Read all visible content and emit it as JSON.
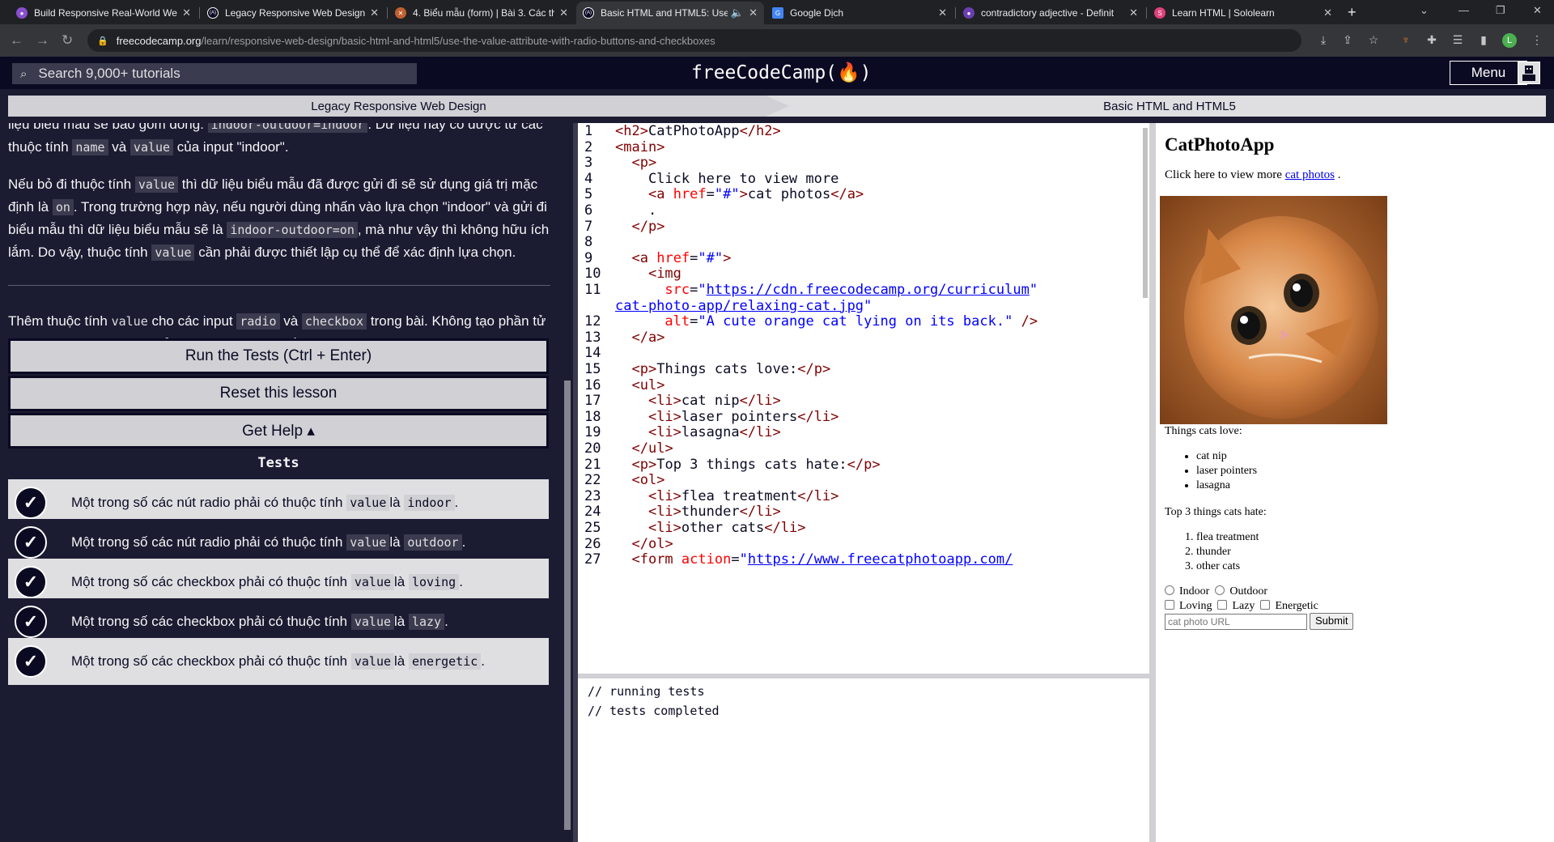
{
  "browser": {
    "tabs": [
      {
        "title": "Build Responsive Real-World We",
        "color": "#8a4fcf",
        "glyph": "●"
      },
      {
        "title": "Legacy Responsive Web Design",
        "color": "#0a0a23",
        "glyph": "(A)"
      },
      {
        "title": "4. Biểu mẫu (form) | Bài 3. Các th",
        "color": "#c06030",
        "glyph": "✕"
      },
      {
        "title": "Basic HTML and HTML5: Use",
        "color": "#0a0a23",
        "glyph": "(A)"
      },
      {
        "title": "Google Dịch",
        "color": "#4285f4",
        "glyph": "G"
      },
      {
        "title": "contradictory adjective - Definit",
        "color": "#6b3fb0",
        "glyph": "●"
      },
      {
        "title": "Learn HTML | Sololearn",
        "color": "#e0407a",
        "glyph": "S"
      }
    ],
    "url_host": "freecodecamp.org",
    "url_path": "/learn/responsive-web-design/basic-html-and-html5/use-the-value-attribute-with-radio-buttons-and-checkboxes",
    "profile_initial": "L"
  },
  "navbar": {
    "search_placeholder": "Search 9,000+ tutorials",
    "brand": "freeCodeCamp(🔥)",
    "menu_label": "Menu"
  },
  "breadcrumb": {
    "course": "Legacy Responsive Web Design",
    "section": "Basic HTML and HTML5"
  },
  "instructions": {
    "p1_pre": "liệu biểu mẫu sẽ bao gồm dòng: ",
    "p1_code1": "indoor-outdoor=indoor",
    "p1_mid": ". Dữ liệu này có được từ các thuộc tính ",
    "p1_code2": "name",
    "p1_and": " và ",
    "p1_code3": "value",
    "p1_post": " của input \"indoor\".",
    "p2_a": "Nếu bỏ đi thuộc tính ",
    "p2_code1": "value",
    "p2_b": " thì dữ liệu biểu mẫu đã được gửi đi sẽ sử dụng giá trị mặc định là ",
    "p2_code2": "on",
    "p2_c": ". Trong trường hợp này, nếu người dùng nhấn vào lựa chọn \"indoor\" và gửi đi biểu mẫu thì dữ liệu biểu mẫu sẽ là ",
    "p2_code3": "indoor-outdoor=on",
    "p2_d": ", mà như vậy thì không hữu ích lắm. Do vậy, thuộc tính ",
    "p2_code4": "value",
    "p2_e": " cần phải được thiết lập cụ thể để xác định lựa chọn.",
    "p3_a": "Thêm thuộc tính ",
    "p3_code1": "value",
    "p3_b": " cho các input ",
    "p3_code2": "radio",
    "p3_c": " và ",
    "p3_code3": "checkbox",
    "p3_d": " trong bài. Không tạo phần tử radio và checkbox mới. Sử dụng nhãn input viết thường làm giá trị thuộc tính."
  },
  "buttons": {
    "run": "Run the Tests (Ctrl + Enter)",
    "reset": "Reset this lesson",
    "help": "Get Help ▴"
  },
  "tests": {
    "heading": "Tests",
    "items": [
      {
        "pre": "Một trong số các nút radio phải có thuộc tính ",
        "code1": "value",
        "mid": " là ",
        "code2": "indoor",
        "post": "."
      },
      {
        "pre": "Một trong số các nút radio phải có thuộc tính ",
        "code1": "value",
        "mid": " là ",
        "code2": "outdoor",
        "post": "."
      },
      {
        "pre": "Một trong số các checkbox phải có thuộc tính ",
        "code1": "value",
        "mid": " là ",
        "code2": "loving",
        "post": "."
      },
      {
        "pre": "Một trong số các checkbox phải có thuộc tính ",
        "code1": "value",
        "mid": " là ",
        "code2": "lazy",
        "post": "."
      },
      {
        "pre": "Một trong số các checkbox phải có thuộc tính ",
        "code1": "value",
        "mid": " là ",
        "code2": "energetic",
        "post": "."
      }
    ]
  },
  "editor": {
    "line_numbers": [
      "1",
      "2",
      "3",
      "4",
      "5",
      "6",
      "7",
      "8",
      "9",
      "10",
      "11",
      "",
      "12",
      "13",
      "14",
      "15",
      "16",
      "17",
      "18",
      "19",
      "20",
      "21",
      "22",
      "23",
      "24",
      "25",
      "26",
      "27"
    ],
    "lines": [
      "<h2>CatPhotoApp</h2>",
      "<main>",
      "  <p>",
      "    Click here to view more",
      "    <a href=\"#\">cat photos</a>",
      "    .",
      "  </p>",
      "",
      "  <a href=\"#\">",
      "    <img",
      "      src=\"https://cdn.freecodecamp.org/curriculum/",
      "cat-photo-app/relaxing-cat.jpg\"",
      "      alt=\"A cute orange cat lying on its back.\" />",
      "  </a>",
      "",
      "  <p>Things cats love:</p>",
      "  <ul>",
      "    <li>cat nip</li>",
      "    <li>laser pointers</li>",
      "    <li>lasagna</li>",
      "  </ul>",
      "  <p>Top 3 things cats hate:</p>",
      "  <ol>",
      "    <li>flea treatment</li>",
      "    <li>thunder</li>",
      "    <li>other cats</li>",
      "  </ol>",
      "  <form action=\"https://www.freecatphotoapp.com/"
    ]
  },
  "console": {
    "lines": [
      "// running tests",
      "// tests completed"
    ]
  },
  "preview": {
    "title": "CatPhotoApp",
    "intro": "Click here to view more ",
    "link": "cat photos",
    "intro_end": " .",
    "img_alt": "A cute orange cat lying on its back.",
    "love_heading": "Things cats love:",
    "love_items": [
      "cat nip",
      "laser pointers",
      "lasagna"
    ],
    "hate_heading": "Top 3 things cats hate:",
    "hate_items": [
      "flea treatment",
      "thunder",
      "other cats"
    ],
    "radios": [
      "Indoor",
      "Outdoor"
    ],
    "checkboxes": [
      "Loving",
      "Lazy",
      "Energetic"
    ],
    "url_placeholder": "cat photo URL",
    "submit": "Submit"
  }
}
